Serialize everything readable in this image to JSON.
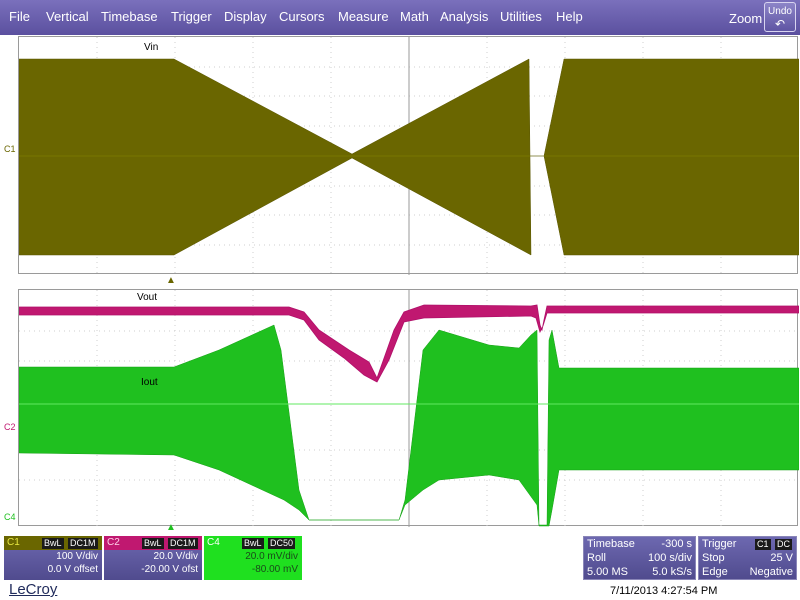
{
  "menu": {
    "items": [
      "File",
      "Vertical",
      "Timebase",
      "Trigger",
      "Display",
      "Cursors",
      "Measure",
      "Math",
      "Analysis",
      "Utilities",
      "Help"
    ],
    "zoom_label": "Zoom",
    "undo_label": "Undo"
  },
  "traces": {
    "vin_label": "Vin",
    "vout_label": "Vout",
    "iout_label": "Iout",
    "c1_marker": "C1",
    "c2_marker": "C2",
    "c4_marker": "C4",
    "colors": {
      "c1": "#6a6600",
      "c2": "#c01870",
      "c4": "#1fc01f"
    }
  },
  "channels": {
    "c1": {
      "name": "C1",
      "bw": "BwL",
      "coupling": "DC1M",
      "scale": "100 V/div",
      "offset": "0.0 V offset"
    },
    "c2": {
      "name": "C2",
      "bw": "BwL",
      "coupling": "DC1M",
      "scale": "20.0 V/div",
      "offset": "-20.00 V ofst"
    },
    "c4": {
      "name": "C4",
      "bw": "BwL",
      "coupling": "DC50",
      "scale": "20.0 mV/div",
      "offset": "-80.00 mV"
    }
  },
  "timebase": {
    "label": "Timebase",
    "delay": "-300 s",
    "mode": "Roll",
    "div": "100 s/div",
    "samples": "5.00 MS",
    "rate": "5.0 kS/s"
  },
  "trigger": {
    "label": "Trigger",
    "source": "C1",
    "coupling": "DC",
    "state": "Stop",
    "level": "25 V",
    "type": "Edge",
    "slope": "Negative"
  },
  "footer": {
    "brand": "LeCroy",
    "datetime": "7/11/2013 4:27:54 PM"
  }
}
